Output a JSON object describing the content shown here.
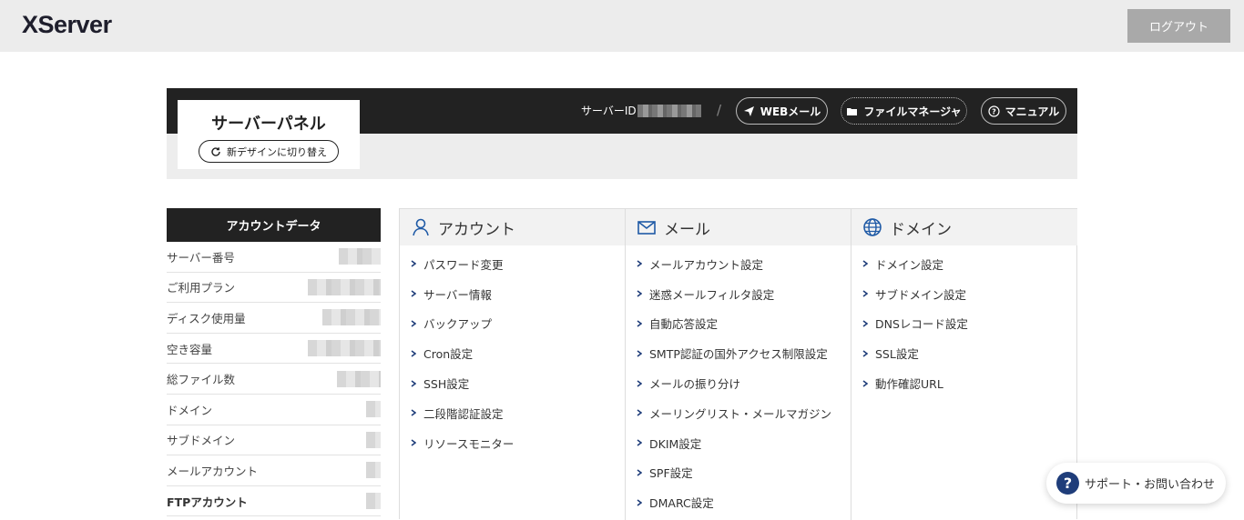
{
  "header": {
    "logo_text": "XServer",
    "logout_label": "ログアウト"
  },
  "panel": {
    "title": "サーバーパネル",
    "switch_design_label": "新デザインに切り替え",
    "server_id_label": "サーバーID",
    "separator": "/",
    "webmail_label": "WEBメール",
    "file_manager_label": "ファイルマネージャ",
    "manual_label": "マニュアル"
  },
  "account_data": {
    "heading": "アカウントデータ",
    "rows": [
      {
        "label": "サーバー番号"
      },
      {
        "label": "ご利用プラン"
      },
      {
        "label": "ディスク使用量"
      },
      {
        "label": "空き容量"
      },
      {
        "label": "総ファイル数"
      },
      {
        "label": "ドメイン"
      },
      {
        "label": "サブドメイン"
      },
      {
        "label": "メールアカウント"
      },
      {
        "label": "FTPアカウント"
      }
    ]
  },
  "menus": {
    "account": {
      "title": "アカウント",
      "items": [
        "パスワード変更",
        "サーバー情報",
        "バックアップ",
        "Cron設定",
        "SSH設定",
        "二段階認証設定",
        "リソースモニター"
      ]
    },
    "mail": {
      "title": "メール",
      "items": [
        "メールアカウント設定",
        "迷惑メールフィルタ設定",
        "自動応答設定",
        "SMTP認証の国外アクセス制限設定",
        "メールの振り分け",
        "メーリングリスト・メールマガジン",
        "DKIM設定",
        "SPF設定",
        "DMARC設定"
      ]
    },
    "domain": {
      "title": "ドメイン",
      "items": [
        "ドメイン設定",
        "サブドメイン設定",
        "DNSレコード設定",
        "SSL設定",
        "動作確認URL"
      ]
    }
  },
  "support": {
    "label": "サポート・お問い合わせ"
  },
  "colors": {
    "dark_bar": "#222222",
    "accent_blue": "#1f3d7a",
    "logout_bg": "#a9a9a9"
  }
}
